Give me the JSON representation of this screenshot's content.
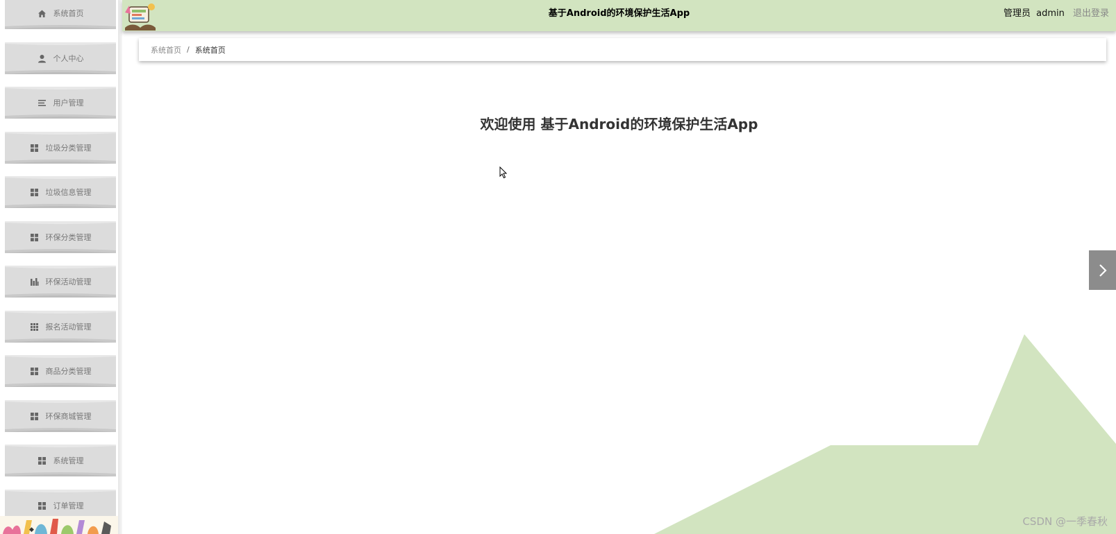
{
  "header": {
    "title": "基于Android的环境保护生活App",
    "user_role": "管理员",
    "username": "admin",
    "logout_label": "退出登录",
    "background": "#d2e4c0"
  },
  "sidebar": {
    "items": [
      {
        "label": "系统首页",
        "icon": "home-icon"
      },
      {
        "label": "个人中心",
        "icon": "user-icon"
      },
      {
        "label": "用户管理",
        "icon": "list-icon"
      },
      {
        "label": "垃圾分类管理",
        "icon": "grid-icon"
      },
      {
        "label": "垃圾信息管理",
        "icon": "grid-icon"
      },
      {
        "label": "环保分类管理",
        "icon": "grid-icon"
      },
      {
        "label": "环保活动管理",
        "icon": "bar-chart-icon"
      },
      {
        "label": "报名活动管理",
        "icon": "apps-icon"
      },
      {
        "label": "商品分类管理",
        "icon": "grid-icon"
      },
      {
        "label": "环保商城管理",
        "icon": "grid-icon"
      },
      {
        "label": "系统管理",
        "icon": "grid-icon"
      },
      {
        "label": "订单管理",
        "icon": "grid-icon"
      }
    ],
    "item_background": "#dcdcdc"
  },
  "breadcrumb": {
    "home": "系统首页",
    "separator": "/",
    "current": "系统首页"
  },
  "main": {
    "welcome_text": "欢迎使用 基于Android的环境保护生活App"
  },
  "next_tab": {
    "icon": "chevron-right-icon"
  },
  "watermark": "CSDN @一季春秋",
  "colors": {
    "accent_green": "#d2e4c0",
    "menu_gray": "#dcdcdc",
    "tab_gray": "#8c8c8c"
  }
}
